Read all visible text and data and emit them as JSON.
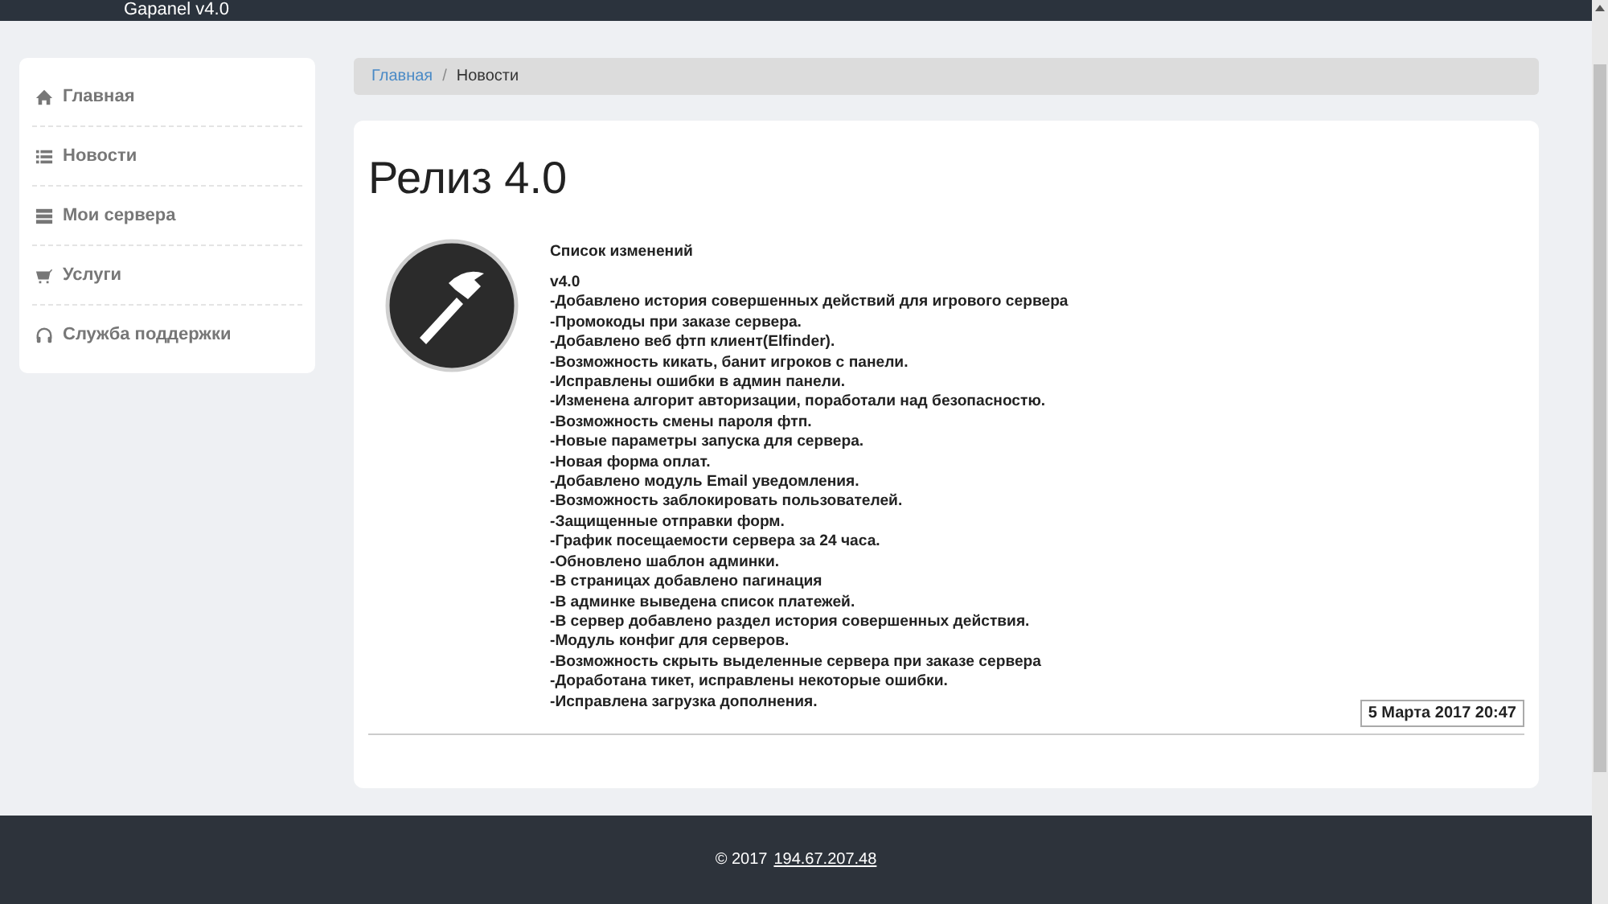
{
  "top_bar": {
    "title": "Gapanel v4.0"
  },
  "sidebar": {
    "items": [
      {
        "label": "Главная"
      },
      {
        "label": "Новости"
      },
      {
        "label": "Мои сервера"
      },
      {
        "label": "Услуги"
      },
      {
        "label": "Служба поддержки"
      }
    ]
  },
  "breadcrumb": [
    {
      "label": "Главная",
      "kind": "link"
    },
    {
      "label": "/",
      "kind": "separator"
    },
    {
      "label": "Новости",
      "kind": "current"
    }
  ],
  "post": {
    "title": "Релиз 4.0",
    "heading": "Список изменений",
    "version": "v4.0",
    "changes": [
      "-Добавлено история совершенных действий для игрового сервера",
      "-Промокоды при заказе сервера.",
      "-Добавлено веб фтп клиент(Elfinder).",
      "-Возможность кикать, банит игроков с панели.",
      "-Исправлены ошибки в админ панели.",
      "-Изменена алгорит авторизации, поработали над безопасностю.",
      "-Возможность смены пароля фтп.",
      "-Новые параметры запуска для сервера.",
      "-Новая форма оплат.",
      "-Добавлено модуль Email уведомления.",
      "-Возможность заблокировать пользователей.",
      "-Защищенные отправки форм.",
      "-График посещаемости сервера за 24 часа.",
      "-Обновлено шаблон админки.",
      "-В страницах добавлено пагинация",
      "-В админке выведена список платежей.",
      "-В сервер добавлено раздел история совершенных действия.",
      "-Модуль конфиг для серверов.",
      "-Возможность скрыть выделенные сервера при заказе сервера",
      "-Доработана тикет, исправлены некоторые ошибки.",
      "-Исправлена загрузка дополнения."
    ],
    "date": "5 Марта 2017 20:47"
  },
  "footer": {
    "copyright": "© 2017",
    "link": "194.67.207.48"
  }
}
